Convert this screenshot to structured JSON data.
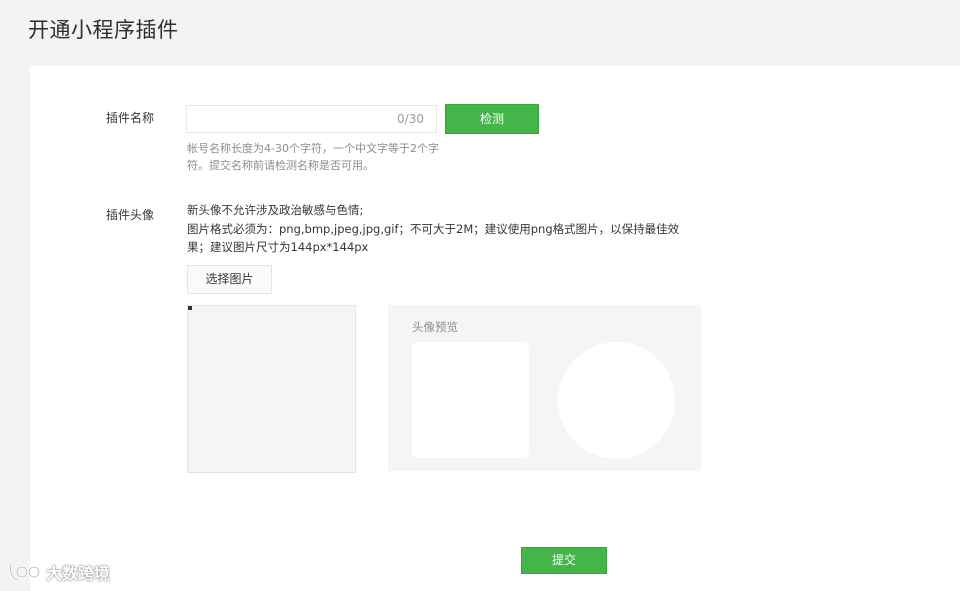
{
  "header": {
    "title": "开通小程序插件"
  },
  "form": {
    "name": {
      "label": "插件名称",
      "value": "",
      "counter": "0/30",
      "check_button": "检测",
      "hint": "帐号名称长度为4-30个字符，一个中文字等于2个字符。提交名称前请检测名称是否可用。"
    },
    "avatar": {
      "label": "插件头像",
      "requirements": [
        "新头像不允许涉及政治敏感与色情;",
        "图片格式必须为：png,bmp,jpeg,jpg,gif；不可大于2M；建议使用png格式图片，以保持最佳效",
        "果；建议图片尺寸为144px*144px"
      ],
      "choose_button": "选择图片",
      "preview_title": "头像预览"
    },
    "submit_button": "提交"
  },
  "watermark": {
    "text": "大数跨境"
  }
}
